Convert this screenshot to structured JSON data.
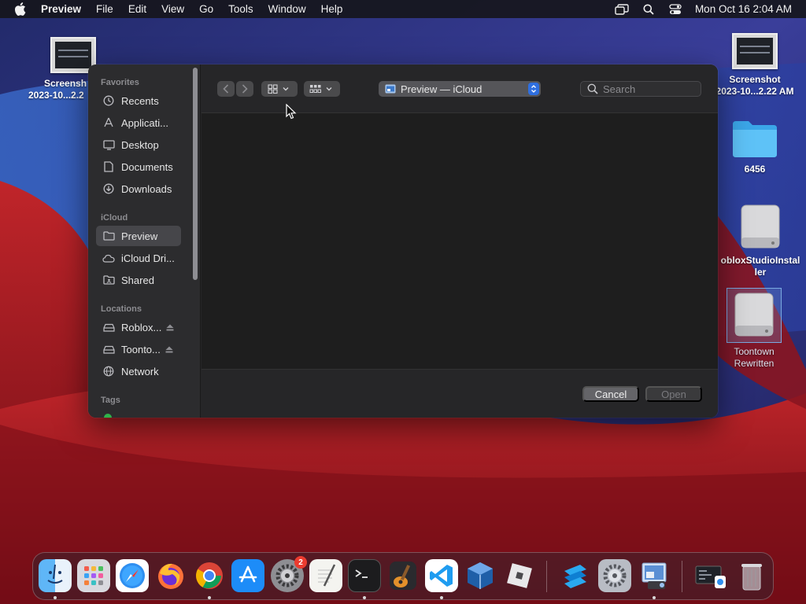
{
  "menubar": {
    "app_name": "Preview",
    "items": [
      "File",
      "Edit",
      "View",
      "Go",
      "Tools",
      "Window",
      "Help"
    ],
    "clock": "Mon Oct 16  2:04 AM",
    "status_icons": [
      "screen-mirroring-icon",
      "search-icon",
      "control-center-icon"
    ]
  },
  "desktop": {
    "icons": [
      {
        "line1": "Screensh",
        "line2": "2023-10...2.2"
      },
      {
        "line1": "Screenshot",
        "line2": "2023-10...2.22 AM"
      },
      {
        "line1": "6456",
        "line2": ""
      },
      {
        "line1": "obloxStudioInstal",
        "line2": "ler"
      },
      {
        "line1": "Toontown",
        "line2": "Rewritten"
      }
    ]
  },
  "dialog": {
    "sidebar": {
      "sections": {
        "favorites": "Favorites",
        "icloud": "iCloud",
        "locations": "Locations",
        "tags": "Tags"
      },
      "favorites": [
        "Recents",
        "Applicati...",
        "Desktop",
        "Documents",
        "Downloads"
      ],
      "icloud": [
        "Preview",
        "iCloud Dri...",
        "Shared"
      ],
      "locations": [
        "Roblox...",
        "Toonto...",
        "Network"
      ]
    },
    "toolbar": {
      "location": "Preview — iCloud",
      "search_placeholder": "Search"
    },
    "buttons": {
      "cancel": "Cancel",
      "open": "Open"
    }
  },
  "dock": {
    "badge_settings": "2",
    "apps": [
      "Finder",
      "Launchpad",
      "Safari",
      "Firefox",
      "Chrome",
      "App Store",
      "System Preferences",
      "TextEdit",
      "Terminal",
      "GarageBand",
      "Visual Studio Code",
      "VirtualBox",
      "Roblox",
      "Roblox Studio",
      "Settings",
      "Preview",
      "Downloads",
      "Trash"
    ]
  },
  "colors": {
    "accent": "#2f6fe0",
    "dialog_bg": "#262628",
    "sidebar_bg": "#2c2c2e",
    "selection": "#46464a"
  }
}
